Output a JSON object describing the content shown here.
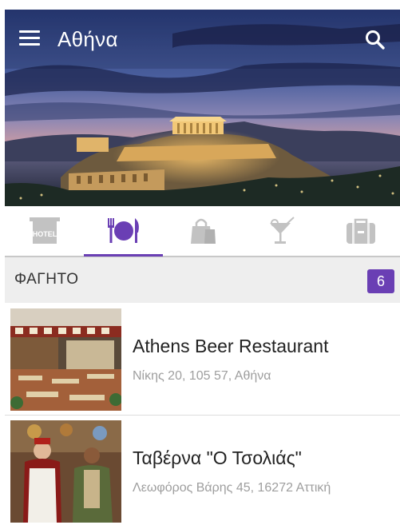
{
  "app": {
    "title": "Αθήνα"
  },
  "icons": {
    "menu": "menu-icon",
    "search": "search-icon",
    "tabs": [
      "hotel-icon",
      "restaurant-icon",
      "shopping-bag-icon",
      "cocktail-icon",
      "luggage-icon"
    ]
  },
  "tabs": [
    {
      "id": "hotel",
      "label": "HOTEL",
      "active": false
    },
    {
      "id": "food",
      "active": true
    },
    {
      "id": "shopping",
      "active": false
    },
    {
      "id": "nightlife",
      "active": false
    },
    {
      "id": "travel",
      "active": false
    }
  ],
  "section": {
    "title": "ΦΑΓΗΤΟ",
    "count": "6"
  },
  "items": [
    {
      "name": "Athens Beer Restaurant",
      "address": "Νίκης 20, 105 57, Αθήνα"
    },
    {
      "name": "Ταβέρνα \"Ο Τσολιάς\"",
      "address": "Λεωφόρος Βάρης 45, 16272 Αττική"
    }
  ],
  "colors": {
    "accent": "#6a3fb4",
    "icon_inactive": "#c2c2c2",
    "section_bg": "#eeeeee"
  }
}
